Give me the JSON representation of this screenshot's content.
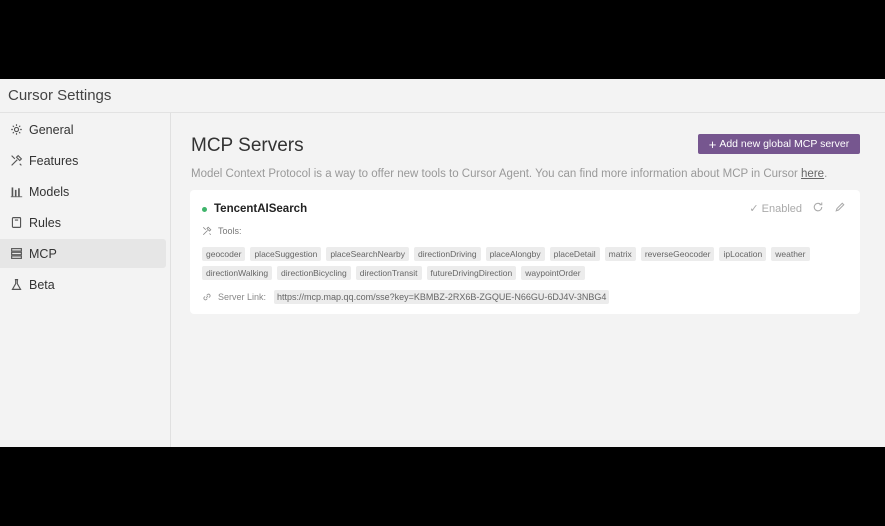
{
  "window": {
    "title": "Cursor Settings"
  },
  "sidebar": {
    "items": [
      {
        "label": "General",
        "icon": "gear-icon"
      },
      {
        "label": "Features",
        "icon": "tools-icon"
      },
      {
        "label": "Models",
        "icon": "bar-chart-icon"
      },
      {
        "label": "Rules",
        "icon": "book-icon"
      },
      {
        "label": "MCP",
        "icon": "server-icon",
        "active": true
      },
      {
        "label": "Beta",
        "icon": "flask-icon"
      }
    ]
  },
  "main": {
    "title": "MCP Servers",
    "add_button": "Add new global MCP server",
    "description": "Model Context Protocol is a way to offer new tools to Cursor Agent. You can find more information about MCP in Cursor ",
    "description_link": "here",
    "description_end": "."
  },
  "server": {
    "name": "TencentAISearch",
    "status": "Enabled",
    "tools_label": "Tools:",
    "tools": [
      "geocoder",
      "placeSuggestion",
      "placeSearchNearby",
      "directionDriving",
      "placeAlongby",
      "placeDetail",
      "matrix",
      "reverseGeocoder",
      "ipLocation",
      "weather",
      "directionWalking",
      "directionBicycling",
      "directionTransit",
      "futureDrivingDirection",
      "waypointOrder"
    ],
    "link_label": "Server Link:",
    "link": "https://mcp.map.qq.com/sse?key=KBMBZ-2RX6B-ZGQUE-N66GU-6DJ4V-3NBG4"
  },
  "colors": {
    "accent": "#76568f",
    "status": "#3fb46b"
  }
}
